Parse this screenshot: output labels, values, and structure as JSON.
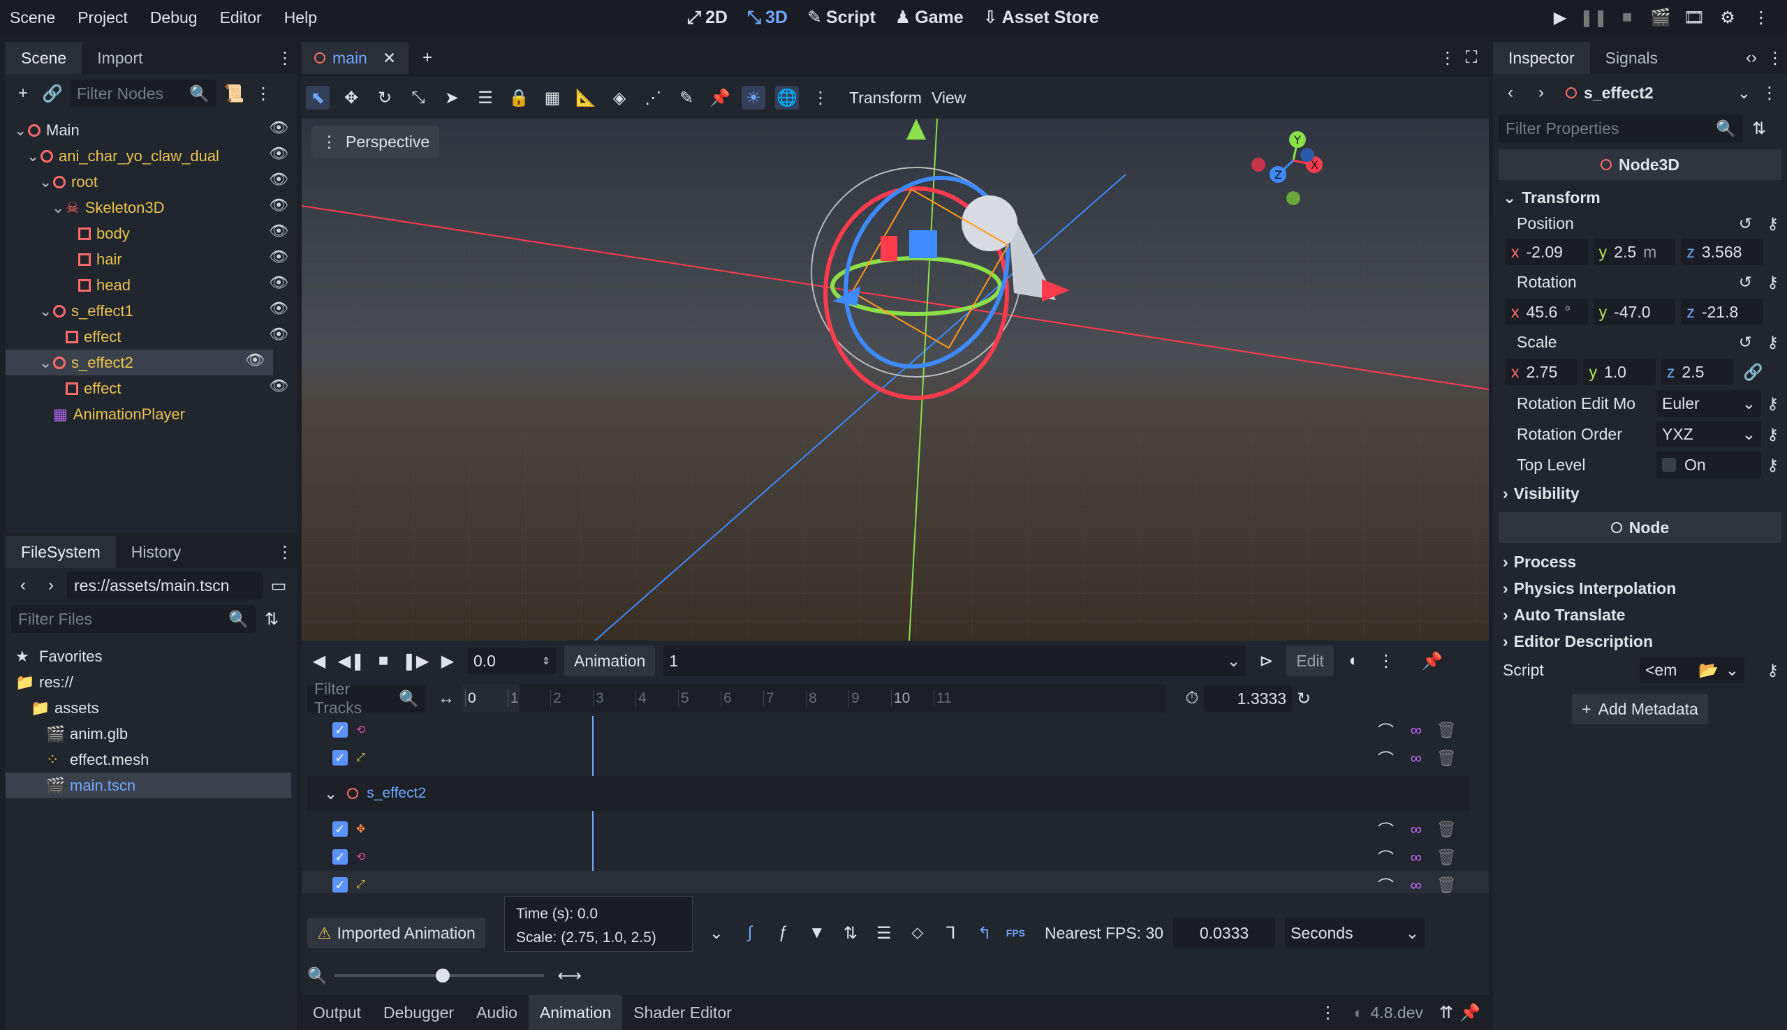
{
  "menu": [
    "Scene",
    "Project",
    "Debug",
    "Editor",
    "Help"
  ],
  "modes": [
    {
      "icon": "⤢",
      "label": "2D",
      "active": false
    },
    {
      "icon": "⤡",
      "label": "3D",
      "active": true
    },
    {
      "icon": "✎",
      "label": "Script",
      "active": false
    },
    {
      "icon": "♟",
      "label": "Game",
      "active": false
    },
    {
      "icon": "⇩",
      "label": "Asset Store",
      "active": false
    }
  ],
  "scene_dock": {
    "tabs": [
      "Scene",
      "Import"
    ],
    "filter_placeholder": "Filter Nodes",
    "tree": [
      {
        "label": "Main",
        "indent": 0,
        "icon": "ring",
        "arrow": "v"
      },
      {
        "label": "ani_char_yo_claw_dual",
        "indent": 1,
        "icon": "ring",
        "arrow": "v"
      },
      {
        "label": "root",
        "indent": 2,
        "icon": "ring",
        "arrow": "v"
      },
      {
        "label": "Skeleton3D",
        "indent": 3,
        "icon": "bone",
        "arrow": "v"
      },
      {
        "label": "body",
        "indent": 4,
        "icon": "mesh",
        "arrow": ""
      },
      {
        "label": "hair",
        "indent": 4,
        "icon": "mesh",
        "arrow": ""
      },
      {
        "label": "head",
        "indent": 4,
        "icon": "mesh",
        "arrow": ""
      },
      {
        "label": "s_effect1",
        "indent": 2,
        "icon": "ring",
        "arrow": "v"
      },
      {
        "label": "effect",
        "indent": 3,
        "icon": "mesh",
        "arrow": ""
      },
      {
        "label": "s_effect2",
        "indent": 2,
        "icon": "ring",
        "arrow": "v",
        "selected": true
      },
      {
        "label": "effect",
        "indent": 3,
        "icon": "mesh",
        "arrow": ""
      },
      {
        "label": "AnimationPlayer",
        "indent": 2,
        "icon": "anim",
        "arrow": ""
      }
    ]
  },
  "filesystem": {
    "tabs": [
      "FileSystem",
      "History"
    ],
    "path": "res://assets/main.tscn",
    "filter_placeholder": "Filter Files",
    "items": [
      {
        "label": "Favorites",
        "indent": 0,
        "icon": "★"
      },
      {
        "label": "res://",
        "indent": 0,
        "icon": "folder"
      },
      {
        "label": "assets",
        "indent": 1,
        "icon": "folder"
      },
      {
        "label": "anim.glb",
        "indent": 2,
        "icon": "scene"
      },
      {
        "label": "effect.mesh",
        "indent": 2,
        "icon": "mesh"
      },
      {
        "label": "main.tscn",
        "indent": 2,
        "icon": "scene",
        "selected": true
      }
    ]
  },
  "viewport": {
    "tab_label": "main",
    "perspective_label": "Perspective",
    "menus": [
      "Transform",
      "View"
    ]
  },
  "animation": {
    "time_value": "0.0",
    "animation_label": "Animation",
    "animation_name": "1",
    "edit_label": "Edit",
    "filter_tracks_placeholder": "Filter Tracks",
    "ruler": [
      "0",
      "1",
      "2",
      "3",
      "4",
      "5",
      "6",
      "7",
      "8",
      "9",
      "10",
      "11"
    ],
    "length": "1.3333",
    "track_group": "s_effect2",
    "tooltip_time": "Time (s): 0.0",
    "tooltip_scale": "Scale: (2.75, 1.0, 2.5)",
    "imported_label": "Imported Animation",
    "nearest_fps": "Nearest FPS: 30",
    "snap_value": "0.0333",
    "snap_unit": "Seconds",
    "fps_badge": "FPS"
  },
  "bottom_tabs": [
    "Output",
    "Debugger",
    "Audio",
    "Animation",
    "Shader Editor"
  ],
  "version": "4.8.dev",
  "inspector": {
    "tabs": [
      "Inspector",
      "Signals"
    ],
    "node_name": "s_effect2",
    "filter_placeholder": "Filter Properties",
    "class_header": "Node3D",
    "transform_label": "Transform",
    "position_label": "Position",
    "position": {
      "x": "-2.09",
      "y": "2.5",
      "y_unit": "m",
      "z": "3.568"
    },
    "rotation_label": "Rotation",
    "rotation": {
      "x": "45.6",
      "x_unit": "°",
      "y": "-47.0",
      "z": "-21.8"
    },
    "scale_label": "Scale",
    "scale": {
      "x": "2.75",
      "y": "1.0",
      "z": "2.5"
    },
    "rotation_edit_mode_label": "Rotation Edit Mo",
    "rotation_edit_mode": "Euler",
    "rotation_order_label": "Rotation Order",
    "rotation_order": "YXZ",
    "top_level_label": "Top Level",
    "top_level_value": "On",
    "visibility_label": "Visibility",
    "node_header": "Node",
    "sections": [
      "Process",
      "Physics Interpolation",
      "Auto Translate",
      "Editor Description"
    ],
    "script_label": "Script",
    "script_value": "<em",
    "add_metadata": "Add Metadata"
  },
  "colors": {
    "accent": "#6fa8ff",
    "node_red": "#ff6b6b",
    "x_axis": "#ff4d5e",
    "y_axis": "#8be04a",
    "z_axis": "#3d8bff"
  }
}
